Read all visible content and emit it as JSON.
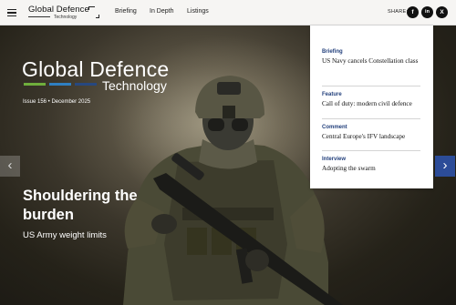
{
  "header": {
    "brand_line1": "Global Defence",
    "brand_line2": "Technology",
    "nav": [
      "Briefing",
      "In Depth",
      "Listings"
    ],
    "share_label": "SHARE:",
    "social": [
      {
        "icon": "facebook-icon",
        "glyph": "f"
      },
      {
        "icon": "linkedin-icon",
        "glyph": "in"
      },
      {
        "icon": "x-icon",
        "glyph": "X"
      }
    ]
  },
  "hero": {
    "logo_title": "Global Defence",
    "logo_subtitle": "Technology",
    "issue": "Issue 156 • December 2025",
    "headline": "Shouldering the burden",
    "subheadline": "US Army weight limits",
    "logo_bar_colors": [
      "#6fae3c",
      "#2f7fc1",
      "#27487f"
    ],
    "arrow_left": "‹",
    "arrow_right": "›"
  },
  "panel": {
    "items": [
      {
        "category": "Briefing",
        "title": "US Navy cancels Constellation class"
      },
      {
        "category": "Feature",
        "title": "Call of duty: modern civil defence"
      },
      {
        "category": "Comment",
        "title": "Central Europe's IFV landscape"
      },
      {
        "category": "Interview",
        "title": "Adopting the swarm"
      }
    ]
  },
  "colors": {
    "accent_navy": "#23407c",
    "arrow_blue": "#2c4c98"
  }
}
